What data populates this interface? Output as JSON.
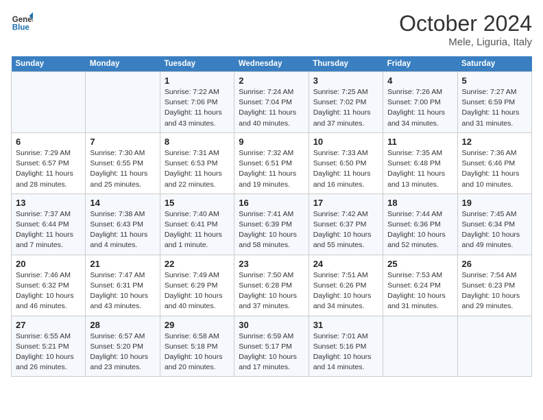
{
  "header": {
    "logo_line1": "General",
    "logo_line2": "Blue",
    "month_title": "October 2024",
    "subtitle": "Mele, Liguria, Italy"
  },
  "weekdays": [
    "Sunday",
    "Monday",
    "Tuesday",
    "Wednesday",
    "Thursday",
    "Friday",
    "Saturday"
  ],
  "weeks": [
    [
      {
        "day": "",
        "sunrise": "",
        "sunset": "",
        "daylight": ""
      },
      {
        "day": "",
        "sunrise": "",
        "sunset": "",
        "daylight": ""
      },
      {
        "day": "1",
        "sunrise": "Sunrise: 7:22 AM",
        "sunset": "Sunset: 7:06 PM",
        "daylight": "Daylight: 11 hours and 43 minutes."
      },
      {
        "day": "2",
        "sunrise": "Sunrise: 7:24 AM",
        "sunset": "Sunset: 7:04 PM",
        "daylight": "Daylight: 11 hours and 40 minutes."
      },
      {
        "day": "3",
        "sunrise": "Sunrise: 7:25 AM",
        "sunset": "Sunset: 7:02 PM",
        "daylight": "Daylight: 11 hours and 37 minutes."
      },
      {
        "day": "4",
        "sunrise": "Sunrise: 7:26 AM",
        "sunset": "Sunset: 7:00 PM",
        "daylight": "Daylight: 11 hours and 34 minutes."
      },
      {
        "day": "5",
        "sunrise": "Sunrise: 7:27 AM",
        "sunset": "Sunset: 6:59 PM",
        "daylight": "Daylight: 11 hours and 31 minutes."
      }
    ],
    [
      {
        "day": "6",
        "sunrise": "Sunrise: 7:29 AM",
        "sunset": "Sunset: 6:57 PM",
        "daylight": "Daylight: 11 hours and 28 minutes."
      },
      {
        "day": "7",
        "sunrise": "Sunrise: 7:30 AM",
        "sunset": "Sunset: 6:55 PM",
        "daylight": "Daylight: 11 hours and 25 minutes."
      },
      {
        "day": "8",
        "sunrise": "Sunrise: 7:31 AM",
        "sunset": "Sunset: 6:53 PM",
        "daylight": "Daylight: 11 hours and 22 minutes."
      },
      {
        "day": "9",
        "sunrise": "Sunrise: 7:32 AM",
        "sunset": "Sunset: 6:51 PM",
        "daylight": "Daylight: 11 hours and 19 minutes."
      },
      {
        "day": "10",
        "sunrise": "Sunrise: 7:33 AM",
        "sunset": "Sunset: 6:50 PM",
        "daylight": "Daylight: 11 hours and 16 minutes."
      },
      {
        "day": "11",
        "sunrise": "Sunrise: 7:35 AM",
        "sunset": "Sunset: 6:48 PM",
        "daylight": "Daylight: 11 hours and 13 minutes."
      },
      {
        "day": "12",
        "sunrise": "Sunrise: 7:36 AM",
        "sunset": "Sunset: 6:46 PM",
        "daylight": "Daylight: 11 hours and 10 minutes."
      }
    ],
    [
      {
        "day": "13",
        "sunrise": "Sunrise: 7:37 AM",
        "sunset": "Sunset: 6:44 PM",
        "daylight": "Daylight: 11 hours and 7 minutes."
      },
      {
        "day": "14",
        "sunrise": "Sunrise: 7:38 AM",
        "sunset": "Sunset: 6:43 PM",
        "daylight": "Daylight: 11 hours and 4 minutes."
      },
      {
        "day": "15",
        "sunrise": "Sunrise: 7:40 AM",
        "sunset": "Sunset: 6:41 PM",
        "daylight": "Daylight: 11 hours and 1 minute."
      },
      {
        "day": "16",
        "sunrise": "Sunrise: 7:41 AM",
        "sunset": "Sunset: 6:39 PM",
        "daylight": "Daylight: 10 hours and 58 minutes."
      },
      {
        "day": "17",
        "sunrise": "Sunrise: 7:42 AM",
        "sunset": "Sunset: 6:37 PM",
        "daylight": "Daylight: 10 hours and 55 minutes."
      },
      {
        "day": "18",
        "sunrise": "Sunrise: 7:44 AM",
        "sunset": "Sunset: 6:36 PM",
        "daylight": "Daylight: 10 hours and 52 minutes."
      },
      {
        "day": "19",
        "sunrise": "Sunrise: 7:45 AM",
        "sunset": "Sunset: 6:34 PM",
        "daylight": "Daylight: 10 hours and 49 minutes."
      }
    ],
    [
      {
        "day": "20",
        "sunrise": "Sunrise: 7:46 AM",
        "sunset": "Sunset: 6:32 PM",
        "daylight": "Daylight: 10 hours and 46 minutes."
      },
      {
        "day": "21",
        "sunrise": "Sunrise: 7:47 AM",
        "sunset": "Sunset: 6:31 PM",
        "daylight": "Daylight: 10 hours and 43 minutes."
      },
      {
        "day": "22",
        "sunrise": "Sunrise: 7:49 AM",
        "sunset": "Sunset: 6:29 PM",
        "daylight": "Daylight: 10 hours and 40 minutes."
      },
      {
        "day": "23",
        "sunrise": "Sunrise: 7:50 AM",
        "sunset": "Sunset: 6:28 PM",
        "daylight": "Daylight: 10 hours and 37 minutes."
      },
      {
        "day": "24",
        "sunrise": "Sunrise: 7:51 AM",
        "sunset": "Sunset: 6:26 PM",
        "daylight": "Daylight: 10 hours and 34 minutes."
      },
      {
        "day": "25",
        "sunrise": "Sunrise: 7:53 AM",
        "sunset": "Sunset: 6:24 PM",
        "daylight": "Daylight: 10 hours and 31 minutes."
      },
      {
        "day": "26",
        "sunrise": "Sunrise: 7:54 AM",
        "sunset": "Sunset: 6:23 PM",
        "daylight": "Daylight: 10 hours and 29 minutes."
      }
    ],
    [
      {
        "day": "27",
        "sunrise": "Sunrise: 6:55 AM",
        "sunset": "Sunset: 5:21 PM",
        "daylight": "Daylight: 10 hours and 26 minutes."
      },
      {
        "day": "28",
        "sunrise": "Sunrise: 6:57 AM",
        "sunset": "Sunset: 5:20 PM",
        "daylight": "Daylight: 10 hours and 23 minutes."
      },
      {
        "day": "29",
        "sunrise": "Sunrise: 6:58 AM",
        "sunset": "Sunset: 5:18 PM",
        "daylight": "Daylight: 10 hours and 20 minutes."
      },
      {
        "day": "30",
        "sunrise": "Sunrise: 6:59 AM",
        "sunset": "Sunset: 5:17 PM",
        "daylight": "Daylight: 10 hours and 17 minutes."
      },
      {
        "day": "31",
        "sunrise": "Sunrise: 7:01 AM",
        "sunset": "Sunset: 5:16 PM",
        "daylight": "Daylight: 10 hours and 14 minutes."
      },
      {
        "day": "",
        "sunrise": "",
        "sunset": "",
        "daylight": ""
      },
      {
        "day": "",
        "sunrise": "",
        "sunset": "",
        "daylight": ""
      }
    ]
  ]
}
